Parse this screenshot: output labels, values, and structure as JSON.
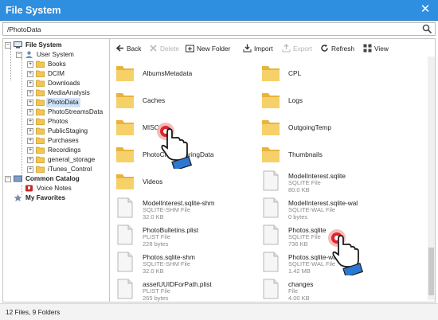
{
  "window": {
    "title": "File System"
  },
  "path": {
    "value": "/PhotoData"
  },
  "toolbar": {
    "back": "Back",
    "delete": "Delete",
    "new_folder": "New Folder",
    "import": "Import",
    "export": "Export",
    "refresh": "Refresh",
    "view": "View"
  },
  "tree": {
    "root": "File System",
    "user_system": "User System",
    "items": [
      "Books",
      "DCIM",
      "Downloads",
      "MediaAnalysis",
      "PhotoData",
      "PhotoStreamsData",
      "Photos",
      "PublicStaging",
      "Purchases",
      "Recordings",
      "general_storage",
      "iTunes_Control"
    ],
    "common_catalog": "Common Catalog",
    "voice_notes": "Voice Notes",
    "favorites": "My Favorites"
  },
  "files": [
    {
      "name": "AlbumsMetadata",
      "kind": "folder"
    },
    {
      "name": "CPL",
      "kind": "folder"
    },
    {
      "name": "Caches",
      "kind": "folder"
    },
    {
      "name": "Logs",
      "kind": "folder"
    },
    {
      "name": "MISC",
      "kind": "folder"
    },
    {
      "name": "OutgoingTemp",
      "kind": "folder"
    },
    {
      "name": "PhotoCloudSharingData",
      "kind": "folder"
    },
    {
      "name": "Thumbnails",
      "kind": "folder"
    },
    {
      "name": "Videos",
      "kind": "folder"
    },
    {
      "name": "ModelInterest.sqlite",
      "kind": "file",
      "type": "SQLITE File",
      "size": "80.0 KB"
    },
    {
      "name": "ModelInterest.sqlite-shm",
      "kind": "file",
      "type": "SQLITE-SHM File",
      "size": "32.0 KB"
    },
    {
      "name": "ModelInterest.sqlite-wal",
      "kind": "file",
      "type": "SQLITE-WAL File",
      "size": "0 bytes"
    },
    {
      "name": "PhotoBulletins.plist",
      "kind": "file",
      "type": "PLIST File",
      "size": "228 bytes"
    },
    {
      "name": "Photos.sqlite",
      "kind": "file",
      "type": "SQLITE File",
      "size": "736 KB"
    },
    {
      "name": "Photos.sqlite-shm",
      "kind": "file",
      "type": "SQLITE-SHM File",
      "size": "32.0 KB"
    },
    {
      "name": "Photos.sqlite-wal",
      "kind": "file",
      "type": "SQLITE-WAL File",
      "size": "1.42 MB"
    },
    {
      "name": "assetUUIDForPath.plist",
      "kind": "file",
      "type": "PLIST File",
      "size": "265 bytes"
    },
    {
      "name": "changes",
      "kind": "file",
      "type": "File",
      "size": "4.00 KB"
    }
  ],
  "status": {
    "text": "12 Files, 9 Folders"
  },
  "colors": {
    "titlebar": "#2e8ee0",
    "selection": "#cfe3f8",
    "folder": "#f3c653",
    "cursor_ring": "#e0242b"
  },
  "icons": {
    "search": "search-icon",
    "close": "close-icon",
    "folder": "folder-icon",
    "file": "document-icon",
    "hand": "hand-pointer-icon"
  }
}
